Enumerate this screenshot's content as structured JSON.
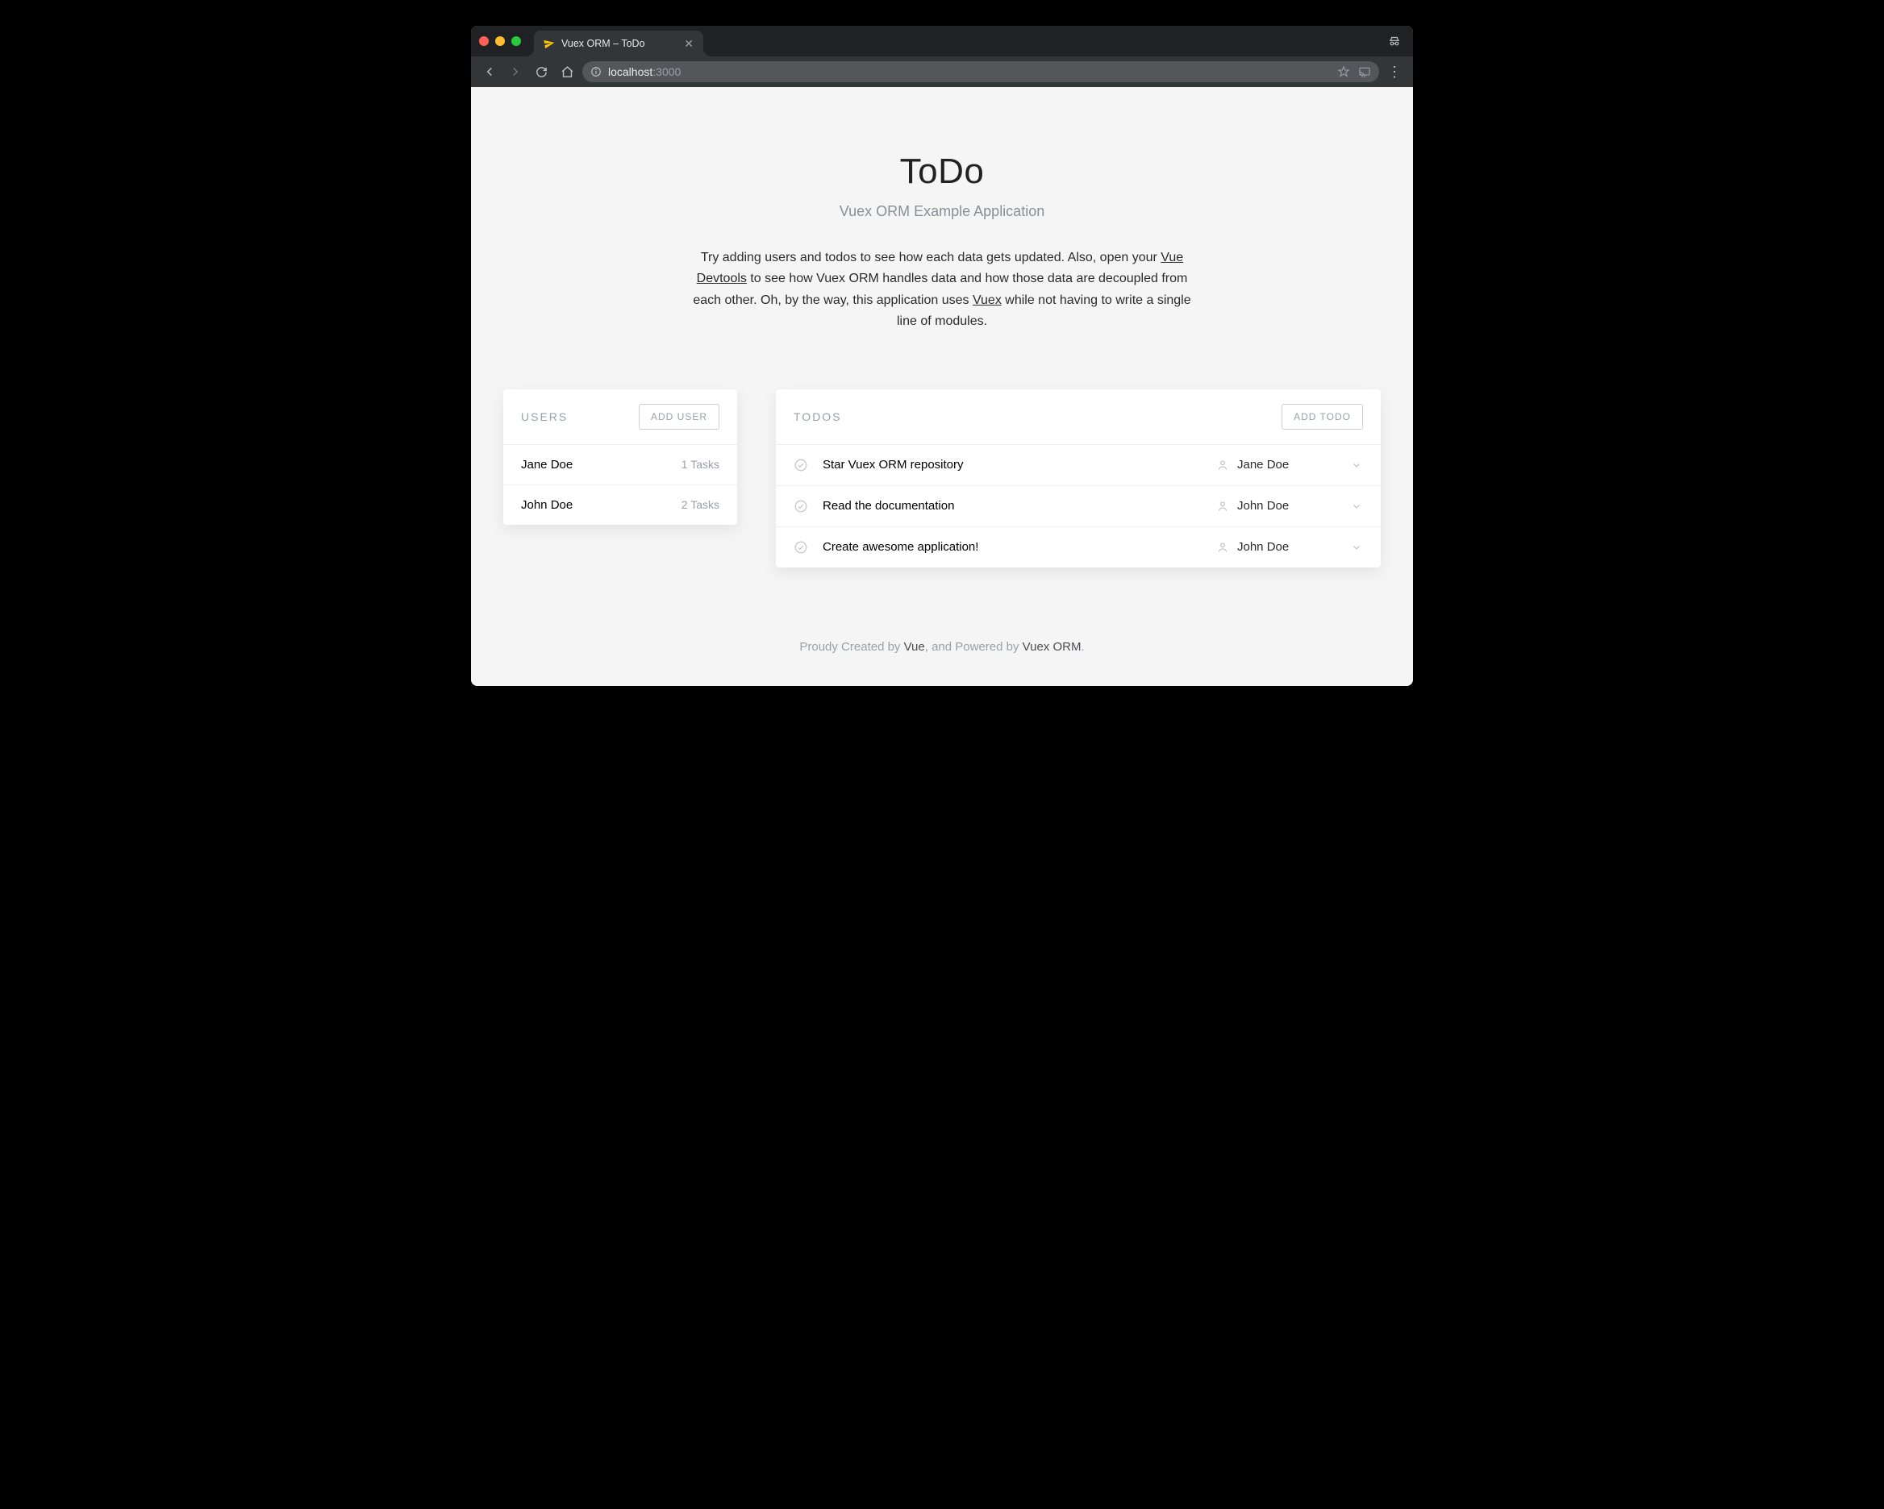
{
  "browser": {
    "tab_title": "Vuex ORM – ToDo",
    "url_host": "localhost",
    "url_path": ":3000"
  },
  "hero": {
    "title": "ToDo",
    "subtitle": "Vuex ORM Example Application",
    "desc_a": "Try adding users and todos to see how each data gets updated. Also, open your ",
    "link1": "Vue Devtools",
    "desc_b": " to see how Vuex ORM handles data and how those data are decoupled from each other. Oh, by the way, this application uses ",
    "link2": "Vuex",
    "desc_c": " while not having to write a single line of modules."
  },
  "users_card": {
    "heading": "USERS",
    "add_label": "ADD USER",
    "rows": [
      {
        "name": "Jane Doe",
        "count": "1 Tasks"
      },
      {
        "name": "John Doe",
        "count": "2 Tasks"
      }
    ]
  },
  "todos_card": {
    "heading": "TODOS",
    "add_label": "ADD TODO",
    "rows": [
      {
        "title": "Star Vuex ORM repository",
        "assignee": "Jane Doe"
      },
      {
        "title": "Read the documentation",
        "assignee": "John Doe"
      },
      {
        "title": "Create awesome application!",
        "assignee": "John Doe"
      }
    ]
  },
  "footer": {
    "a": "Proudy Created by ",
    "vue": "Vue",
    "b": ", and Powered by ",
    "orm": "Vuex ORM",
    "c": "."
  }
}
